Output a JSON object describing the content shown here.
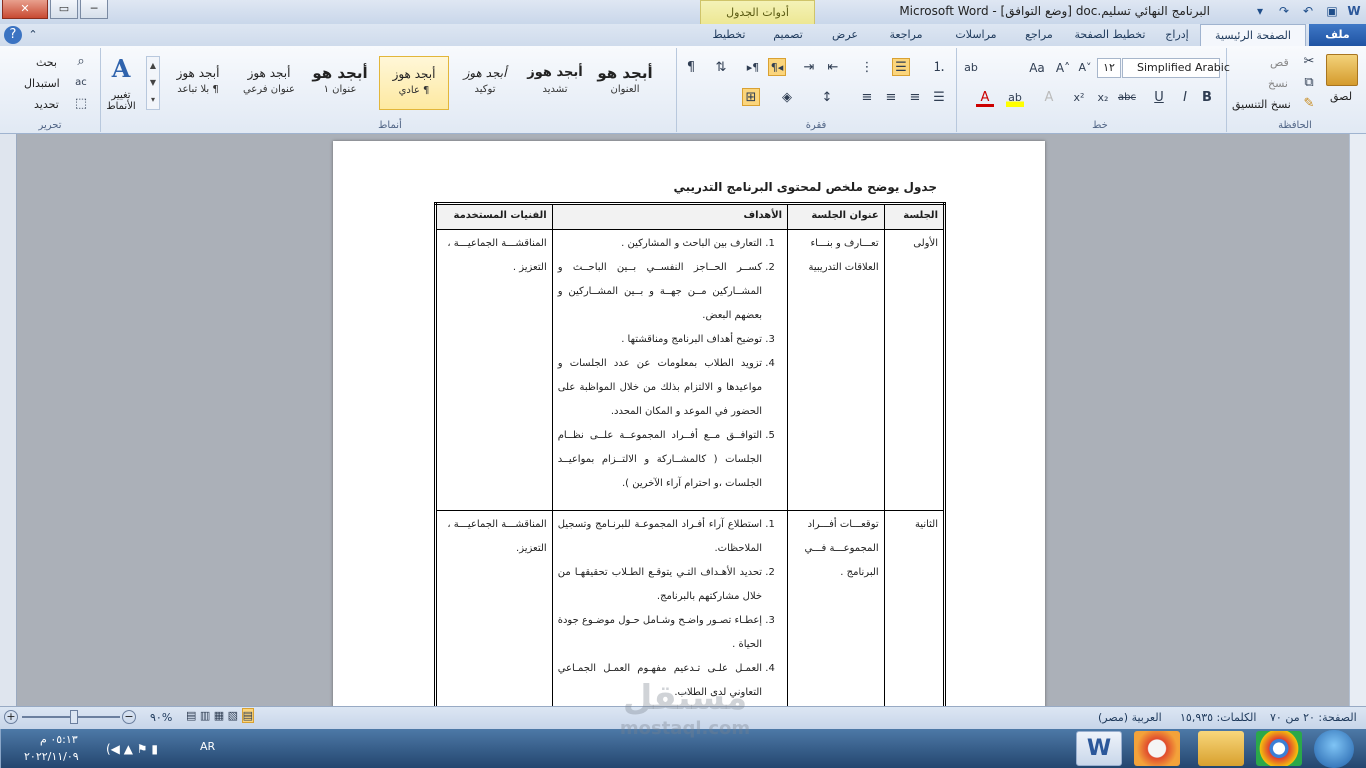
{
  "window": {
    "document_title": "البرنامج النهائي تسليم.doc [وضع التوافق] - Microsoft Word",
    "context_group": "أدوات الجدول",
    "close_symbol": "✕",
    "max_symbol": "▭",
    "min_symbol": "─"
  },
  "tabs": {
    "file": "ملف",
    "home": "الصفحة الرئيسية",
    "insert": "إدراج",
    "page_layout": "تخطيط الصفحة",
    "references": "مراجع",
    "mailings": "مراسلات",
    "review": "مراجعة",
    "view": "عرض",
    "design": "تصميم",
    "layout": "تخطيط"
  },
  "ribbon": {
    "clipboard": {
      "label": "الحافظة",
      "paste": "لصق",
      "cut": "قص",
      "copy": "نسخ",
      "format_painter": "نسخ التنسيق"
    },
    "font": {
      "label": "خط",
      "font_name": "Simplified Arabic",
      "font_size": "١٢"
    },
    "paragraph": {
      "label": "فقرة"
    },
    "styles": {
      "label": "أنماط",
      "items": [
        {
          "sample": "أبجد هو",
          "name": "العنوان"
        },
        {
          "sample": "أبجد هوز",
          "name": "تشديد"
        },
        {
          "sample": "أبجد هوز",
          "name": "توكيد"
        },
        {
          "sample": "أبجد هوز",
          "name": "¶ عادي"
        },
        {
          "sample": "أبجد هو",
          "name": "عنوان ١"
        },
        {
          "sample": "أبجد هوز",
          "name": "عنوان فرعي"
        },
        {
          "sample": "أبجد هوز",
          "name": "¶ بلا تباعد"
        }
      ],
      "change_styles": "تغيير الأنماط"
    },
    "editing": {
      "label": "تحرير",
      "find": "بحث",
      "replace": "استبدال",
      "select": "تحديد"
    }
  },
  "document": {
    "caption": "جدول يوضح ملخص لمحتوى البرنامج التدريبي",
    "table": {
      "headers": [
        "الجلسة",
        "عنوان الجلسة",
        "الأهداف",
        "الفنيات المستخدمة"
      ],
      "rows": [
        {
          "session": "الأولى",
          "title": "تعـــارف و بنـــاء العلاقات التدريبية",
          "goals": [
            "التعارف بين الباحث و المشاركين .",
            "كســر الحــاجز النفســي بــين الباحــث و المشــاركين مــن جهــة و بــين المشــاركين و بعضهم البعض.",
            "توضيح أهداف البرنامج ومناقشتها .",
            "تزويد الطلاب بمعلومات عن عدد الجلسات و مواعيدها و الالتزام بذلك من خلال المواظبة على الحضور في الموعد و المكان المحدد.",
            "التوافــق مــع أفــراد المجموعــة علــى نظــام الجلسات ( كالمشــاركة و الالتــزام بمواعيــد الجلسات ،و احترام آراء الآخرين )."
          ],
          "techniques": "المناقشـــة الجماعيـــة ، التعزيز ."
        },
        {
          "session": "الثانية",
          "title": "توقعـــات أفـــراد المجموعـــة فـــي البرنامج .",
          "goals": [
            "استطلاع آراء أفـراد المجموعـة للبرنـامج وتسجيل الملاحظات.",
            "تحديد الأهـداف التـي يتوقـع الطـلاب تحقيقهـا من خلال مشاركتهم بالبرنامج.",
            "إعطـاء تصـور واضـح وشـامل حـول موضـوع جودة الحياة .",
            "العمـل علـى تـدعيم مفهـوم العمـل الجمـاعي التعاوني لدى الطلاب."
          ],
          "techniques": "المناقشـــة الجماعيـــة ، التعزيز."
        }
      ]
    }
  },
  "statusbar": {
    "page": "الصفحة: ٢٠ من ٧٠",
    "words": "الكلمات: ١٥,٩٣٥",
    "language": "العربية (مصر)",
    "zoom": "%٩٠"
  },
  "taskbar": {
    "lang": "AR",
    "time": "٠٥:١٣ م",
    "date": "٢٠٢٢/١١/٠٩"
  },
  "watermark": {
    "text_ar": "مستقل",
    "text_en": "mostaql.com"
  }
}
